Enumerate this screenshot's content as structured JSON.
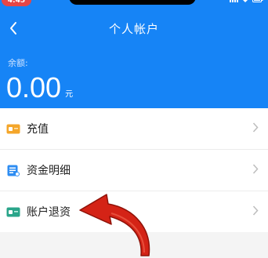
{
  "status_bar": {
    "time": "4:45"
  },
  "header": {
    "title": "个人帐户",
    "balance_label": "余额:",
    "balance_amount": "0.00",
    "balance_unit": "元",
    "color": "#1684f6"
  },
  "menu": {
    "items": [
      {
        "label": "充值",
        "icon": "recharge-card-icon",
        "icon_color": "#f4a62a"
      },
      {
        "label": "资金明细",
        "icon": "fund-details-icon",
        "icon_color": "#2e8df2"
      },
      {
        "label": "账户退资",
        "icon": "account-refund-icon",
        "icon_color": "#2aa58a"
      }
    ]
  },
  "annotation": {
    "arrow_color": "#d42316"
  }
}
